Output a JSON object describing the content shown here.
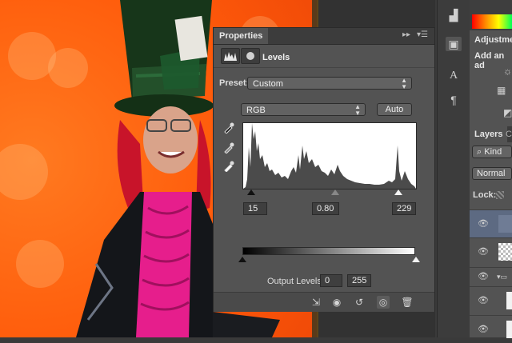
{
  "properties": {
    "tab_title": "Properties",
    "panel_title": "Levels",
    "preset_label": "Preset:",
    "preset_value": "Custom",
    "channel_value": "RGB",
    "auto_label": "Auto",
    "input_black": "15",
    "input_gamma": "0.80",
    "input_white": "229",
    "output_label": "Output Levels:",
    "output_black": "0",
    "output_white": "255"
  },
  "right_panel": {
    "adjustments_title": "Adjustmen",
    "add_adjustment": "Add an ad",
    "layers_tab": "Layers",
    "layers_tab2": "C",
    "kind_label": "Kind",
    "blend_mode": "Normal",
    "lock_label": "Lock:"
  },
  "colors": {
    "panel_bg": "#535353",
    "canvas_orange": "#ff5a0a",
    "hat_green": "#1f4a22",
    "shirt_pink": "#e61e8c"
  }
}
